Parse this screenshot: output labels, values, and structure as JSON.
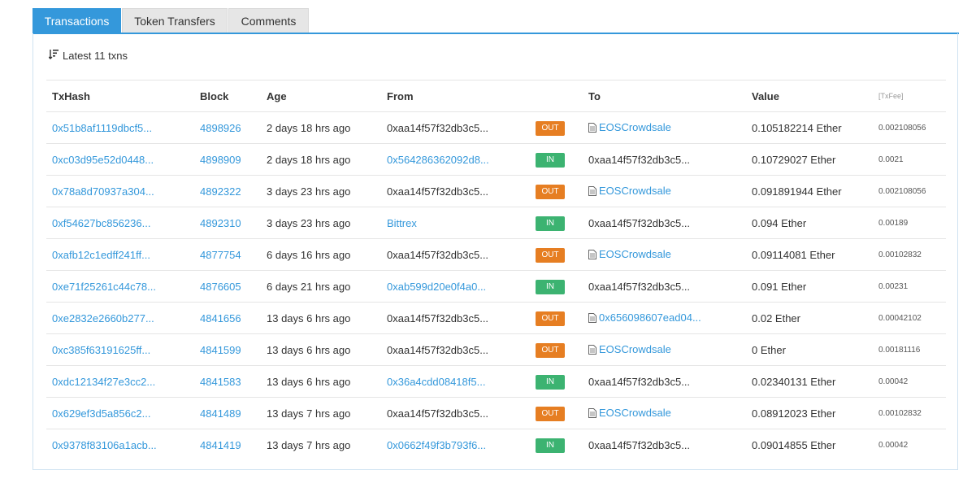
{
  "tabs": [
    {
      "label": "Transactions",
      "active": true
    },
    {
      "label": "Token Transfers",
      "active": false
    },
    {
      "label": "Comments",
      "active": false
    }
  ],
  "summary": {
    "label": "Latest 11 txns",
    "icon": "sort-icon"
  },
  "table": {
    "headers": {
      "txhash": "TxHash",
      "block": "Block",
      "age": "Age",
      "from": "From",
      "to": "To",
      "value": "Value",
      "fee": "[TxFee]"
    },
    "rows": [
      {
        "txhash": "0x51b8af1119dbcf5...",
        "block": "4898926",
        "age": "2 days 18 hrs ago",
        "from": "0xaa14f57f32db3c5...",
        "from_link": false,
        "dir": "OUT",
        "to": "EOSCrowdsale",
        "to_link": true,
        "to_contract": true,
        "value": "0.105182214 Ether",
        "fee": "0.002108056"
      },
      {
        "txhash": "0xc03d95e52d0448...",
        "block": "4898909",
        "age": "2 days 18 hrs ago",
        "from": "0x564286362092d8...",
        "from_link": true,
        "dir": "IN",
        "to": "0xaa14f57f32db3c5...",
        "to_link": false,
        "to_contract": false,
        "value": "0.10729027 Ether",
        "fee": "0.0021"
      },
      {
        "txhash": "0x78a8d70937a304...",
        "block": "4892322",
        "age": "3 days 23 hrs ago",
        "from": "0xaa14f57f32db3c5...",
        "from_link": false,
        "dir": "OUT",
        "to": "EOSCrowdsale",
        "to_link": true,
        "to_contract": true,
        "value": "0.091891944 Ether",
        "fee": "0.002108056"
      },
      {
        "txhash": "0xf54627bc856236...",
        "block": "4892310",
        "age": "3 days 23 hrs ago",
        "from": "Bittrex",
        "from_link": true,
        "dir": "IN",
        "to": "0xaa14f57f32db3c5...",
        "to_link": false,
        "to_contract": false,
        "value": "0.094 Ether",
        "fee": "0.00189"
      },
      {
        "txhash": "0xafb12c1edff241ff...",
        "block": "4877754",
        "age": "6 days 16 hrs ago",
        "from": "0xaa14f57f32db3c5...",
        "from_link": false,
        "dir": "OUT",
        "to": "EOSCrowdsale",
        "to_link": true,
        "to_contract": true,
        "value": "0.09114081 Ether",
        "fee": "0.00102832"
      },
      {
        "txhash": "0xe71f25261c44c78...",
        "block": "4876605",
        "age": "6 days 21 hrs ago",
        "from": "0xab599d20e0f4a0...",
        "from_link": true,
        "dir": "IN",
        "to": "0xaa14f57f32db3c5...",
        "to_link": false,
        "to_contract": false,
        "value": "0.091 Ether",
        "fee": "0.00231"
      },
      {
        "txhash": "0xe2832e2660b277...",
        "block": "4841656",
        "age": "13 days 6 hrs ago",
        "from": "0xaa14f57f32db3c5...",
        "from_link": false,
        "dir": "OUT",
        "to": "0x656098607ead04...",
        "to_link": true,
        "to_contract": true,
        "value": "0.02 Ether",
        "fee": "0.00042102"
      },
      {
        "txhash": "0xc385f63191625ff...",
        "block": "4841599",
        "age": "13 days 6 hrs ago",
        "from": "0xaa14f57f32db3c5...",
        "from_link": false,
        "dir": "OUT",
        "to": "EOSCrowdsale",
        "to_link": true,
        "to_contract": true,
        "value": "0 Ether",
        "fee": "0.00181116"
      },
      {
        "txhash": "0xdc12134f27e3cc2...",
        "block": "4841583",
        "age": "13 days 6 hrs ago",
        "from": "0x36a4cdd08418f5...",
        "from_link": true,
        "dir": "IN",
        "to": "0xaa14f57f32db3c5...",
        "to_link": false,
        "to_contract": false,
        "value": "0.02340131 Ether",
        "fee": "0.00042"
      },
      {
        "txhash": "0x629ef3d5a856c2...",
        "block": "4841489",
        "age": "13 days 7 hrs ago",
        "from": "0xaa14f57f32db3c5...",
        "from_link": false,
        "dir": "OUT",
        "to": "EOSCrowdsale",
        "to_link": true,
        "to_contract": true,
        "value": "0.08912023 Ether",
        "fee": "0.00102832"
      },
      {
        "txhash": "0x9378f83106a1acb...",
        "block": "4841419",
        "age": "13 days 7 hrs ago",
        "from": "0x0662f49f3b793f6...",
        "from_link": true,
        "dir": "IN",
        "to": "0xaa14f57f32db3c5...",
        "to_link": false,
        "to_contract": false,
        "value": "0.09014855 Ether",
        "fee": "0.00042"
      }
    ]
  },
  "colors": {
    "accent": "#3498db",
    "out_badge": "#e67e22",
    "in_badge": "#3cb371"
  }
}
